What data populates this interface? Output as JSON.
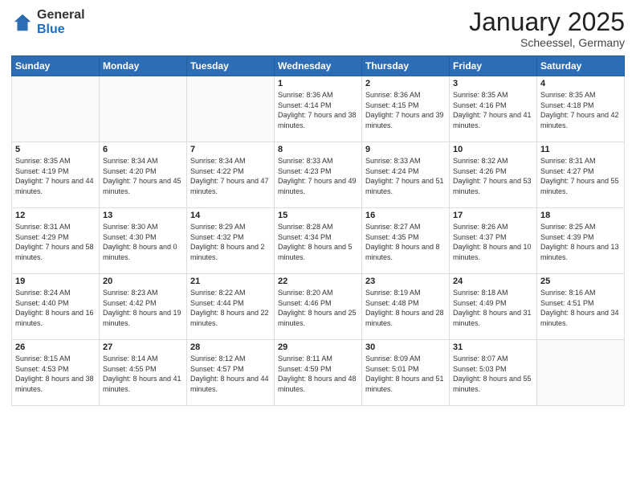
{
  "logo": {
    "general": "General",
    "blue": "Blue"
  },
  "header": {
    "month": "January 2025",
    "location": "Scheessel, Germany"
  },
  "weekdays": [
    "Sunday",
    "Monday",
    "Tuesday",
    "Wednesday",
    "Thursday",
    "Friday",
    "Saturday"
  ],
  "weeks": [
    [
      {
        "day": "",
        "sunrise": "",
        "sunset": "",
        "daylight": ""
      },
      {
        "day": "",
        "sunrise": "",
        "sunset": "",
        "daylight": ""
      },
      {
        "day": "",
        "sunrise": "",
        "sunset": "",
        "daylight": ""
      },
      {
        "day": "1",
        "sunrise": "Sunrise: 8:36 AM",
        "sunset": "Sunset: 4:14 PM",
        "daylight": "Daylight: 7 hours and 38 minutes."
      },
      {
        "day": "2",
        "sunrise": "Sunrise: 8:36 AM",
        "sunset": "Sunset: 4:15 PM",
        "daylight": "Daylight: 7 hours and 39 minutes."
      },
      {
        "day": "3",
        "sunrise": "Sunrise: 8:35 AM",
        "sunset": "Sunset: 4:16 PM",
        "daylight": "Daylight: 7 hours and 41 minutes."
      },
      {
        "day": "4",
        "sunrise": "Sunrise: 8:35 AM",
        "sunset": "Sunset: 4:18 PM",
        "daylight": "Daylight: 7 hours and 42 minutes."
      }
    ],
    [
      {
        "day": "5",
        "sunrise": "Sunrise: 8:35 AM",
        "sunset": "Sunset: 4:19 PM",
        "daylight": "Daylight: 7 hours and 44 minutes."
      },
      {
        "day": "6",
        "sunrise": "Sunrise: 8:34 AM",
        "sunset": "Sunset: 4:20 PM",
        "daylight": "Daylight: 7 hours and 45 minutes."
      },
      {
        "day": "7",
        "sunrise": "Sunrise: 8:34 AM",
        "sunset": "Sunset: 4:22 PM",
        "daylight": "Daylight: 7 hours and 47 minutes."
      },
      {
        "day": "8",
        "sunrise": "Sunrise: 8:33 AM",
        "sunset": "Sunset: 4:23 PM",
        "daylight": "Daylight: 7 hours and 49 minutes."
      },
      {
        "day": "9",
        "sunrise": "Sunrise: 8:33 AM",
        "sunset": "Sunset: 4:24 PM",
        "daylight": "Daylight: 7 hours and 51 minutes."
      },
      {
        "day": "10",
        "sunrise": "Sunrise: 8:32 AM",
        "sunset": "Sunset: 4:26 PM",
        "daylight": "Daylight: 7 hours and 53 minutes."
      },
      {
        "day": "11",
        "sunrise": "Sunrise: 8:31 AM",
        "sunset": "Sunset: 4:27 PM",
        "daylight": "Daylight: 7 hours and 55 minutes."
      }
    ],
    [
      {
        "day": "12",
        "sunrise": "Sunrise: 8:31 AM",
        "sunset": "Sunset: 4:29 PM",
        "daylight": "Daylight: 7 hours and 58 minutes."
      },
      {
        "day": "13",
        "sunrise": "Sunrise: 8:30 AM",
        "sunset": "Sunset: 4:30 PM",
        "daylight": "Daylight: 8 hours and 0 minutes."
      },
      {
        "day": "14",
        "sunrise": "Sunrise: 8:29 AM",
        "sunset": "Sunset: 4:32 PM",
        "daylight": "Daylight: 8 hours and 2 minutes."
      },
      {
        "day": "15",
        "sunrise": "Sunrise: 8:28 AM",
        "sunset": "Sunset: 4:34 PM",
        "daylight": "Daylight: 8 hours and 5 minutes."
      },
      {
        "day": "16",
        "sunrise": "Sunrise: 8:27 AM",
        "sunset": "Sunset: 4:35 PM",
        "daylight": "Daylight: 8 hours and 8 minutes."
      },
      {
        "day": "17",
        "sunrise": "Sunrise: 8:26 AM",
        "sunset": "Sunset: 4:37 PM",
        "daylight": "Daylight: 8 hours and 10 minutes."
      },
      {
        "day": "18",
        "sunrise": "Sunrise: 8:25 AM",
        "sunset": "Sunset: 4:39 PM",
        "daylight": "Daylight: 8 hours and 13 minutes."
      }
    ],
    [
      {
        "day": "19",
        "sunrise": "Sunrise: 8:24 AM",
        "sunset": "Sunset: 4:40 PM",
        "daylight": "Daylight: 8 hours and 16 minutes."
      },
      {
        "day": "20",
        "sunrise": "Sunrise: 8:23 AM",
        "sunset": "Sunset: 4:42 PM",
        "daylight": "Daylight: 8 hours and 19 minutes."
      },
      {
        "day": "21",
        "sunrise": "Sunrise: 8:22 AM",
        "sunset": "Sunset: 4:44 PM",
        "daylight": "Daylight: 8 hours and 22 minutes."
      },
      {
        "day": "22",
        "sunrise": "Sunrise: 8:20 AM",
        "sunset": "Sunset: 4:46 PM",
        "daylight": "Daylight: 8 hours and 25 minutes."
      },
      {
        "day": "23",
        "sunrise": "Sunrise: 8:19 AM",
        "sunset": "Sunset: 4:48 PM",
        "daylight": "Daylight: 8 hours and 28 minutes."
      },
      {
        "day": "24",
        "sunrise": "Sunrise: 8:18 AM",
        "sunset": "Sunset: 4:49 PM",
        "daylight": "Daylight: 8 hours and 31 minutes."
      },
      {
        "day": "25",
        "sunrise": "Sunrise: 8:16 AM",
        "sunset": "Sunset: 4:51 PM",
        "daylight": "Daylight: 8 hours and 34 minutes."
      }
    ],
    [
      {
        "day": "26",
        "sunrise": "Sunrise: 8:15 AM",
        "sunset": "Sunset: 4:53 PM",
        "daylight": "Daylight: 8 hours and 38 minutes."
      },
      {
        "day": "27",
        "sunrise": "Sunrise: 8:14 AM",
        "sunset": "Sunset: 4:55 PM",
        "daylight": "Daylight: 8 hours and 41 minutes."
      },
      {
        "day": "28",
        "sunrise": "Sunrise: 8:12 AM",
        "sunset": "Sunset: 4:57 PM",
        "daylight": "Daylight: 8 hours and 44 minutes."
      },
      {
        "day": "29",
        "sunrise": "Sunrise: 8:11 AM",
        "sunset": "Sunset: 4:59 PM",
        "daylight": "Daylight: 8 hours and 48 minutes."
      },
      {
        "day": "30",
        "sunrise": "Sunrise: 8:09 AM",
        "sunset": "Sunset: 5:01 PM",
        "daylight": "Daylight: 8 hours and 51 minutes."
      },
      {
        "day": "31",
        "sunrise": "Sunrise: 8:07 AM",
        "sunset": "Sunset: 5:03 PM",
        "daylight": "Daylight: 8 hours and 55 minutes."
      },
      {
        "day": "",
        "sunrise": "",
        "sunset": "",
        "daylight": ""
      }
    ]
  ]
}
